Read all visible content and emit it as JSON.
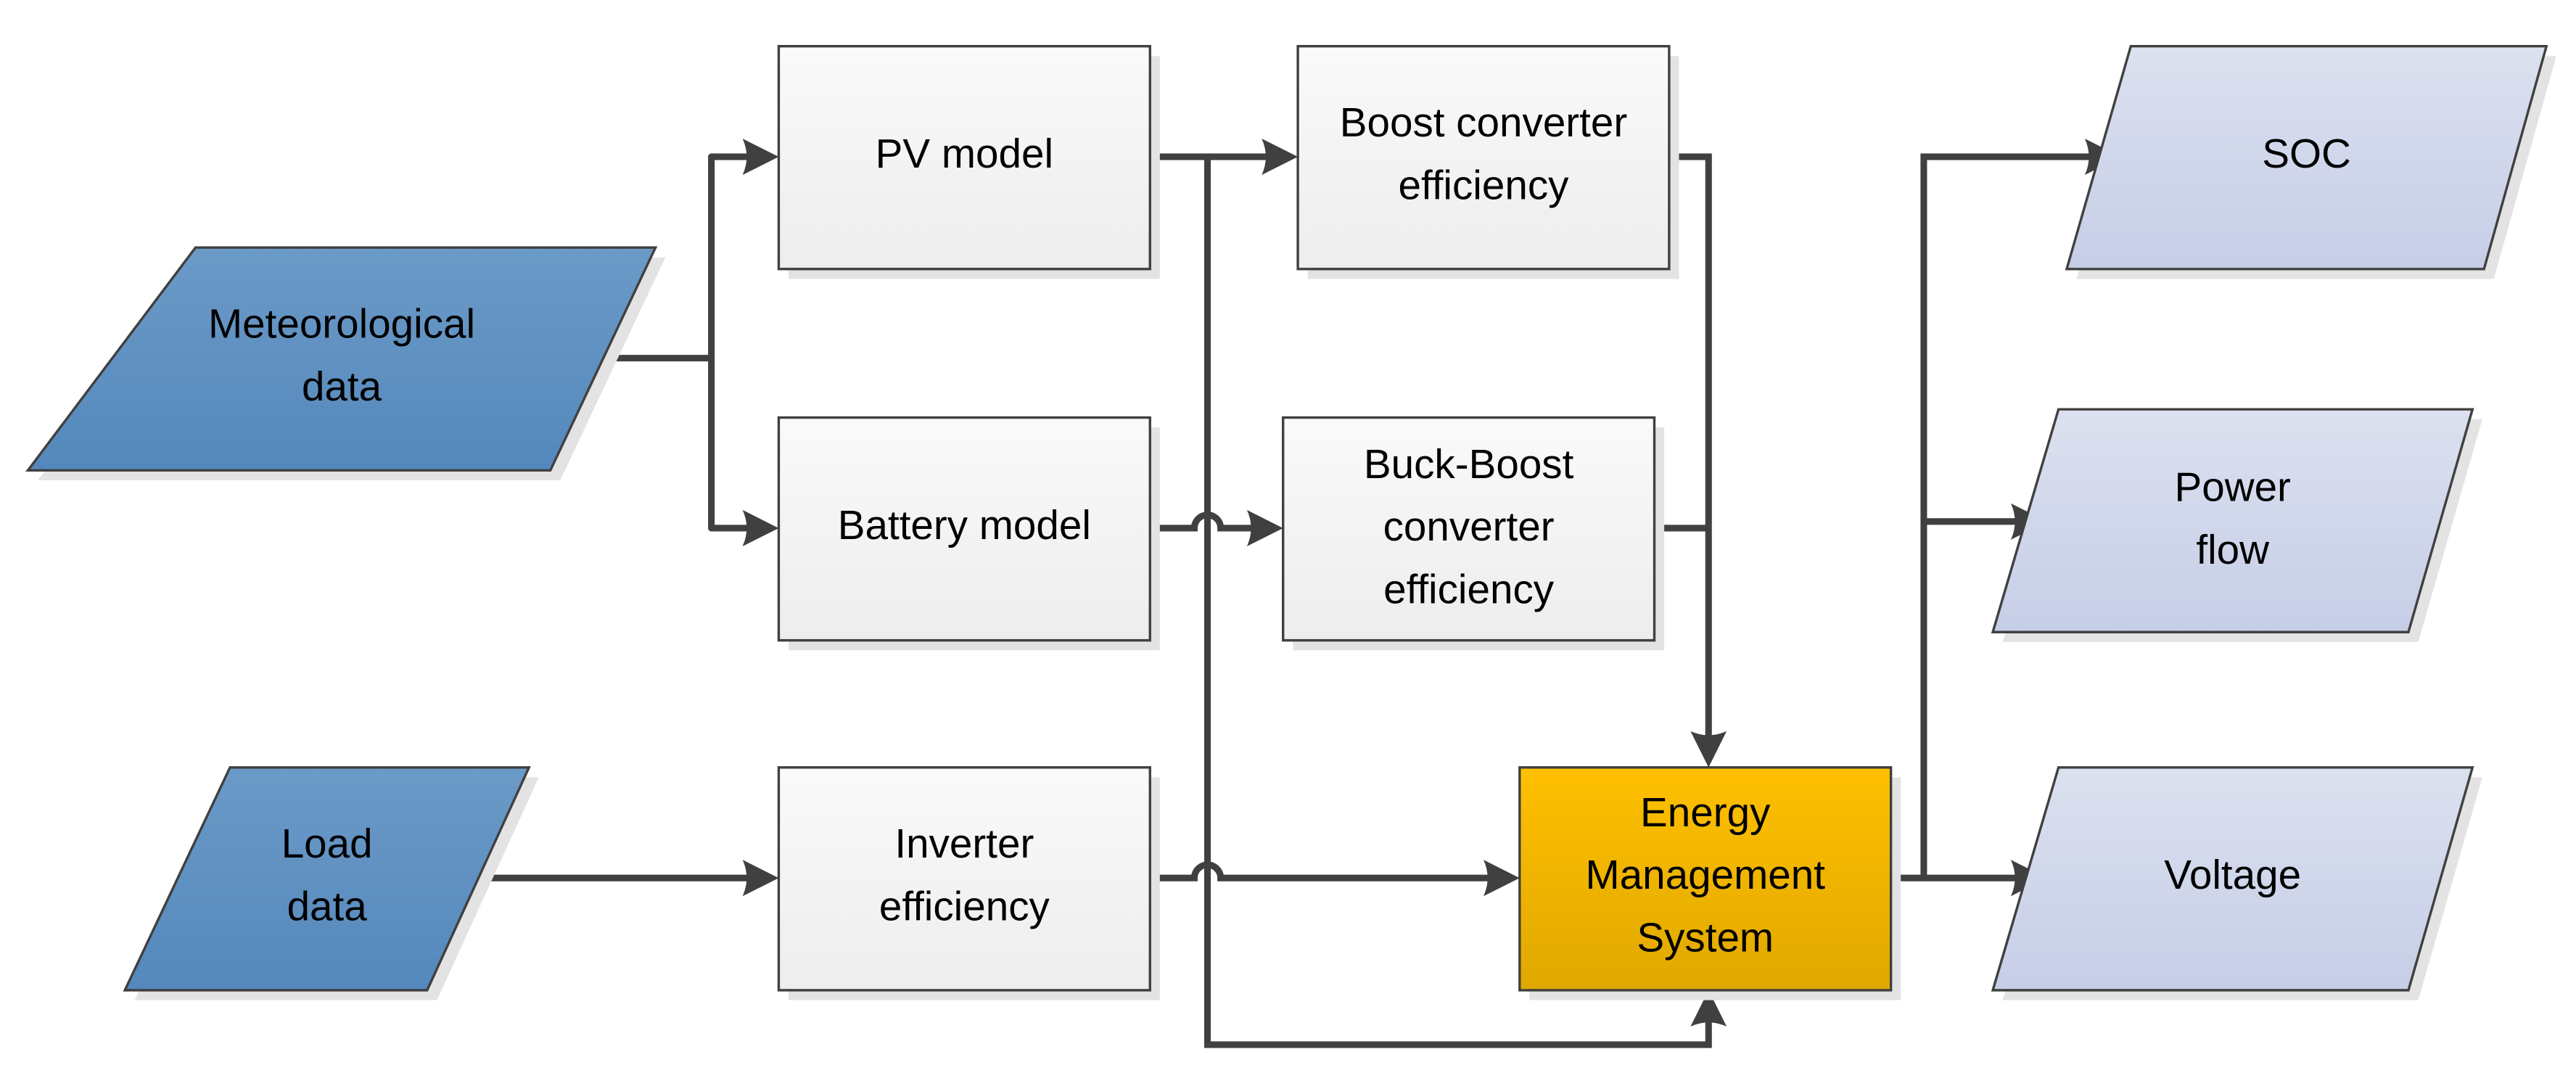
{
  "diagram": {
    "type": "flowchart",
    "colors": {
      "input_fill_top": "#6B9AC7",
      "input_fill_bottom": "#5488BC",
      "process_fill_top": "#FAFAFA",
      "process_fill_bottom": "#EDEDED",
      "ems_fill_top": "#FFC000",
      "ems_fill_bottom": "#E0A800",
      "output_fill_top": "#DCE1EF",
      "output_fill_bottom": "#C6CEE7",
      "line": "#404040"
    },
    "inputs": [
      {
        "id": "meteorological",
        "lines": [
          "Meteorological",
          "data"
        ]
      },
      {
        "id": "load",
        "lines": [
          "Load",
          "data"
        ]
      }
    ],
    "processes": [
      {
        "id": "pv",
        "lines": [
          "PV model"
        ]
      },
      {
        "id": "battery",
        "lines": [
          "Battery model"
        ]
      },
      {
        "id": "inverter",
        "lines": [
          "Inverter",
          "efficiency"
        ]
      },
      {
        "id": "boost",
        "lines": [
          "Boost converter",
          "efficiency"
        ]
      },
      {
        "id": "buckboost",
        "lines": [
          "Buck-Boost",
          "converter",
          "efficiency"
        ]
      },
      {
        "id": "ems",
        "lines": [
          "Energy",
          "Management",
          "System"
        ]
      }
    ],
    "outputs": [
      {
        "id": "soc",
        "lines": [
          "SOC"
        ]
      },
      {
        "id": "powerflow",
        "lines": [
          "Power",
          "flow"
        ]
      },
      {
        "id": "voltage",
        "lines": [
          "Voltage"
        ]
      }
    ],
    "connections": [
      {
        "from": "meteorological",
        "to": "pv"
      },
      {
        "from": "meteorological",
        "to": "battery"
      },
      {
        "from": "load",
        "to": "inverter"
      },
      {
        "from": "pv",
        "to": "boost"
      },
      {
        "from": "pv",
        "to": "ems"
      },
      {
        "from": "battery",
        "to": "buckboost"
      },
      {
        "from": "inverter",
        "to": "ems"
      },
      {
        "from": "boost",
        "to": "ems"
      },
      {
        "from": "buckboost",
        "to": "ems"
      },
      {
        "from": "ems",
        "to": "soc"
      },
      {
        "from": "ems",
        "to": "powerflow"
      },
      {
        "from": "ems",
        "to": "voltage"
      }
    ]
  }
}
